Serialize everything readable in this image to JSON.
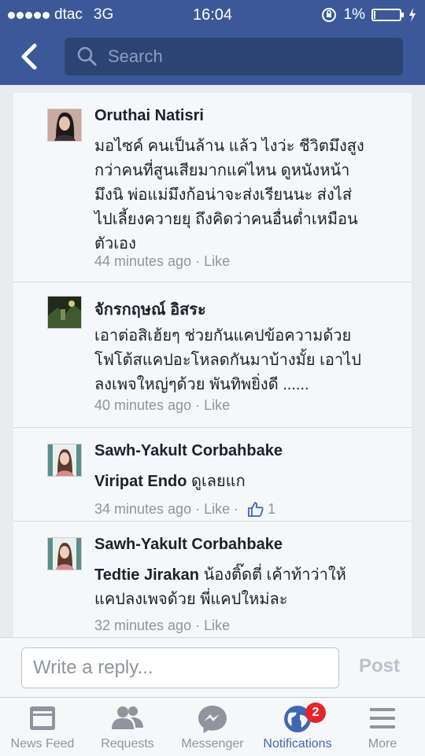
{
  "status_bar": {
    "carrier": "dtac",
    "network": "3G",
    "time": "16:04",
    "battery": "1%"
  },
  "nav": {
    "search_placeholder": "Search"
  },
  "comments": [
    {
      "author": "Oruthai Natisri",
      "mention": "",
      "lines": [
        "มอไซค์ คนเป็นล้าน แล้ว ไงว่ะ ชีวิตมึงสูง",
        "กว่าคนที่สูนเสียมากแค่ไหน ดูหนังหน้า",
        "มึงนิ พ่อแม่มึงก้อน่าจะส่งเรียนนะ ส่งไส่",
        "ไปเลี้ยงควายยุ ถึงคิดว่าคนอื่นต่ำเหมือน",
        "ตัวเอง"
      ],
      "time": "44 minutes ago",
      "like": "Like",
      "like_count": ""
    },
    {
      "author": "จักรกฤษณ์ อิสระ",
      "mention": "",
      "lines": [
        "เอาต่อสิเฮ้ยๆ ช่วยกันแคปข้อความด้วย",
        "โฟโต้สแคปอะโหลดกันมาบ้างมั้ย เอาไป",
        "ลงเพจใหญ่ๆด้วย พันทิพยิ่งดี ......"
      ],
      "time": "40 minutes ago",
      "like": "Like",
      "like_count": ""
    },
    {
      "author": "Sawh-Yakult Corbahbake",
      "mention": "Viripat Endo",
      "lines": [
        " ดูเลยแก"
      ],
      "time": "34 minutes ago",
      "like": "Like",
      "like_count": "1"
    },
    {
      "author": "Sawh-Yakult Corbahbake",
      "mention": "Tedtie Jirakan",
      "lines": [
        " น้องติ๊ดตี่ เค้าท้าว่าให้",
        "แคปลงเพจด้วย พี่แคปใหม่ละ"
      ],
      "time": "32 minutes ago",
      "like": "Like",
      "like_count": ""
    }
  ],
  "reply": {
    "placeholder": "Write a reply...",
    "post_label": "Post"
  },
  "tabs": [
    {
      "label": "News Feed",
      "icon": "news-feed-icon"
    },
    {
      "label": "Requests",
      "icon": "friend-requests-icon"
    },
    {
      "label": "Messenger",
      "icon": "messenger-icon"
    },
    {
      "label": "Notifications",
      "icon": "globe-icon",
      "badge": "2",
      "active": true
    },
    {
      "label": "More",
      "icon": "menu-lines-icon"
    }
  ],
  "colors": {
    "brand": "#3b5998",
    "link_blue": "#4267b2",
    "badge_red": "#e4262b",
    "meta_gray": "#90949c"
  }
}
